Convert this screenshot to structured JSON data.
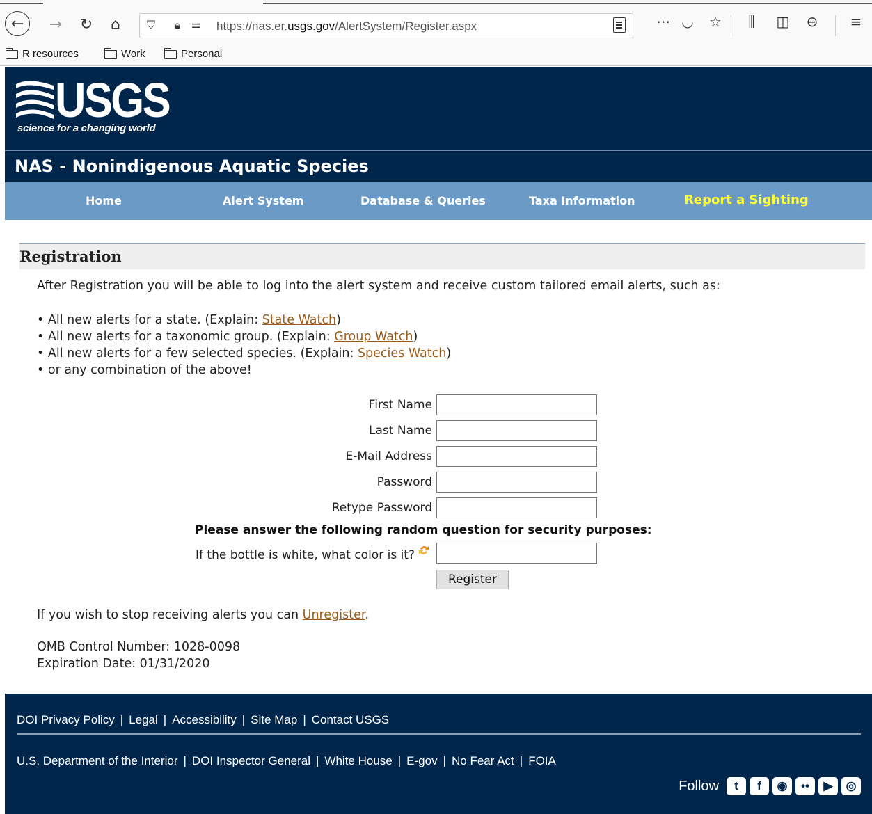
{
  "browser": {
    "url_prefix": "https://nas.er.",
    "url_domain": "usgs.gov",
    "url_path": "/AlertSystem/Register.aspx",
    "bookmarks": [
      "R resources",
      "Work",
      "Personal"
    ]
  },
  "header": {
    "logo_text": "USGS",
    "logo_tagline": "science for a changing world",
    "site_title": "NAS - Nonindigenous Aquatic Species"
  },
  "nav": {
    "items": [
      "Home",
      "Alert System",
      "Database & Queries",
      "Taxa Information",
      "Report a Sighting"
    ],
    "highlight_color": "#ffff33"
  },
  "registration": {
    "heading": "Registration",
    "intro": "After Registration you will be able to log into the alert system and receive custom tailored email alerts, such as:",
    "bullets": [
      {
        "text": "All new alerts for a state. (Explain: ",
        "link": "State Watch",
        "end": ")"
      },
      {
        "text": "All new alerts for a taxonomic group. (Explain: ",
        "link": "Group Watch",
        "end": ")"
      },
      {
        "text": "All new alerts for a few selected species. (Explain: ",
        "link": "Species Watch",
        "end": ")"
      },
      {
        "text": "or any combination of the above!",
        "link": "",
        "end": ""
      }
    ],
    "fields": {
      "first_name": "First Name",
      "last_name": "Last Name",
      "email": "E-Mail Address",
      "password": "Password",
      "retype_password": "Retype Password"
    },
    "security_prompt": "Please answer the following random question for security purposes:",
    "security_question": "If the bottle is white, what color is it?",
    "register_button": "Register",
    "unregister_text": "If you wish to stop receiving alerts you can ",
    "unregister_link": "Unregister",
    "unregister_end": ".",
    "omb_control": "OMB Control Number: 1028-0098",
    "expiration": "Expiration Date: 01/31/2020"
  },
  "footer": {
    "row1": [
      "DOI Privacy Policy",
      "Legal",
      "Accessibility",
      "Site Map",
      "Contact USGS"
    ],
    "row2": [
      "U.S. Department of the Interior",
      "DOI Inspector General",
      "White House",
      "E-gov",
      "No Fear Act",
      "FOIA"
    ],
    "follow_label": "Follow",
    "social_icons": [
      "twitter-icon",
      "facebook-icon",
      "github-icon",
      "flickr-icon",
      "youtube-icon",
      "instagram-icon"
    ]
  },
  "colors": {
    "header_bg": "#00264c",
    "nav_bg": "#6b9ac6",
    "link": "#9a5c1a"
  }
}
